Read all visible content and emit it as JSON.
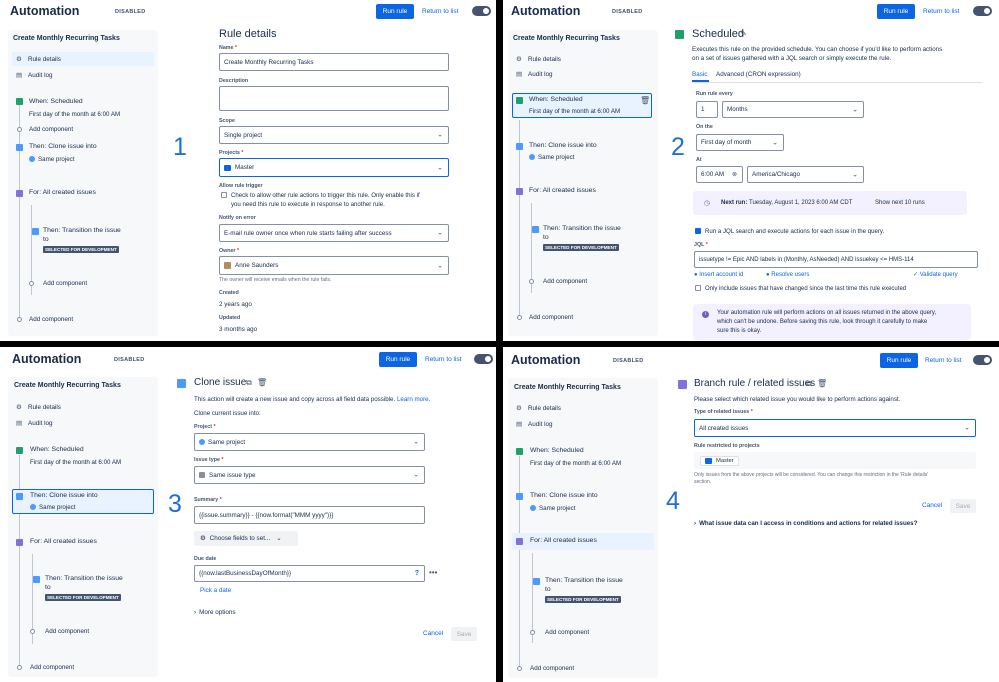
{
  "app": {
    "title": "Automation",
    "status": "DISABLED",
    "run_rule": "Run rule",
    "return": "Return to list"
  },
  "sidebar": {
    "rule_name": "Create Monthly Recurring Tasks",
    "nav": [
      "Rule details",
      "Audit log"
    ],
    "when_title": "When: Scheduled",
    "when_sub": "First day of the month at 6:00 AM",
    "add_component": "Add component",
    "clone_title": "Then: Clone issue into",
    "clone_sub": "Same project",
    "for_title": "For: All created issues",
    "transition_title_1": "Then: Transition the issue",
    "transition_title_2": "to",
    "transition_status": "SELECTED FOR DEVELOPMENT"
  },
  "steps": [
    "1",
    "2",
    "3",
    "4"
  ],
  "rule_details": {
    "title": "Rule details",
    "name_label": "Name",
    "name_value": "Create Monthly Recurring Tasks",
    "description_label": "Description",
    "scope_label": "Scope",
    "scope_value": "Single project",
    "projects_label": "Projects",
    "projects_value": "Master",
    "allow_label": "Allow rule trigger",
    "allow_text_1": "Check to allow other rule actions to trigger this rule. Only enable this if",
    "allow_text_2": "you need this rule to execute in response to another rule.",
    "notify_label": "Notify on error",
    "notify_value": "E-mail rule owner once when rule starts failing after success",
    "owner_label": "Owner",
    "owner_value": "Anne Saunders",
    "owner_help": "The owner will receive emails when the rule fails.",
    "created_label": "Created",
    "created_value": "2 years ago",
    "updated_label": "Updated",
    "updated_value": "3 months ago"
  },
  "scheduled": {
    "title": "Scheduled",
    "desc_1": "Executes this rule on the provided schedule. You can choose if you'd like to perform actions",
    "desc_2": "on a set of issues gathered with a JQL search or simply execute the rule.",
    "tab_basic": "Basic",
    "tab_advanced": "Advanced (CRON expression)",
    "run_every_label": "Run rule every",
    "run_every_value": "1",
    "run_every_unit": "Months",
    "on_the_label": "On the",
    "on_the_value": "First day of month",
    "at_label": "At",
    "at_time": "6:00 AM",
    "timezone": "America/Chicago",
    "next_run_label": "Next run:",
    "next_run_value": "Tuesday, August 1, 2023 6:00 AM CDT",
    "show_next": "Show next 10 runs",
    "jql_check": "Run a JQL search and execute actions for each issue in the query.",
    "jql_label": "JQL",
    "jql_value": "issuetype != Epic AND labels in (Monthly, AsNeeded) AND issuekey <= HMS-114",
    "insert_account": "Insert account id",
    "resolve_users": "Resolve users",
    "validate_query": "Validate query",
    "only_changed": "Only include issues that have changed since the last time this rule executed",
    "warning_1": "Your automation rule will perform actions on all issues returned in the above query,",
    "warning_2": "which can't be undone. Before saving this rule, look through it carefully to make",
    "warning_3": "sure this is okay."
  },
  "clone": {
    "title": "Clone issue",
    "desc": "This action will create a new issue and copy across all field data possible.",
    "learn_more": "Learn more.",
    "clone_into": "Clone current issue into:",
    "project_label": "Project",
    "project_value": "Same project",
    "issue_type_label": "Issue type",
    "issue_type_value": "Same issue type",
    "summary_label": "Summary",
    "summary_value": "{{issue.summary}} - {{now.format(\"MMM yyyy\")}}",
    "choose_fields": "Choose fields to set...",
    "due_label": "Due date",
    "due_value": "{{now.lastBusinessDayOfMonth}}",
    "pick_date": "Pick a date",
    "more_options": "More options",
    "cancel": "Cancel",
    "save": "Save"
  },
  "branch": {
    "title": "Branch rule / related issues",
    "desc": "Please select which related issue you would like to perform actions against.",
    "type_label": "Type of related issues",
    "type_value": "All created issues",
    "restricted_label": "Rule restricted to projects",
    "restricted_value": "Master",
    "help_1": "Only issues from the above projects will be considered. You can change this restriction in the 'Rule details'",
    "help_2": "section.",
    "cancel": "Cancel",
    "save": "Save",
    "question": "What issue data can I access in conditions and actions for related issues?"
  },
  "colors": {
    "accent": "#0c66e4",
    "step_number": "#1f6fd1",
    "selected_bg": "#e9f2ff",
    "info_bg": "#f3f0ff"
  }
}
